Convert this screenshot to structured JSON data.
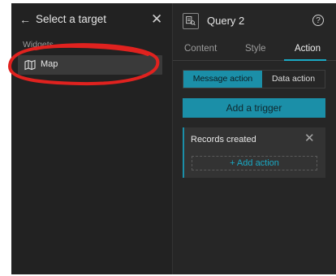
{
  "left_panel": {
    "title": "Select a target",
    "section_label": "Widgets",
    "items": [
      {
        "label": "Map",
        "icon": "map-icon"
      }
    ]
  },
  "right_panel": {
    "widget_title": "Query 2",
    "tabs": [
      {
        "label": "Content",
        "active": false
      },
      {
        "label": "Style",
        "active": false
      },
      {
        "label": "Action",
        "active": true
      }
    ],
    "segments": [
      {
        "label": "Message action",
        "active": true
      },
      {
        "label": "Data action",
        "active": false
      }
    ],
    "add_trigger_label": "Add a trigger",
    "trigger_card": {
      "title": "Records created",
      "add_action_label": "+ Add action"
    }
  },
  "colors": {
    "accent": "#1b8fa8",
    "accent_text": "#1aa9c4",
    "annotation": "#e0221f"
  }
}
